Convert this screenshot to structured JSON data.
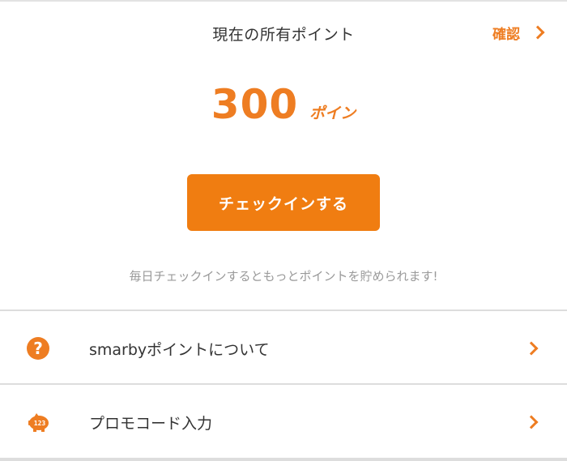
{
  "header": {
    "title": "現在の所有ポイント",
    "confirm_label": "確認"
  },
  "points": {
    "value": "300",
    "unit": "ポイン"
  },
  "checkin": {
    "button_label": "チェックインする",
    "hint": "毎日チェックインするともっとポイントを貯められます!"
  },
  "menu": {
    "items": [
      {
        "label": "smarbyポイントについて",
        "icon": "question-circle-icon"
      },
      {
        "label": "プロモコード入力",
        "icon": "piggy-bank-123-icon"
      }
    ]
  },
  "colors": {
    "accent": "#ee7d22",
    "button": "#f07d11",
    "hint_text": "#9a9a9a",
    "divider": "#dddddd"
  }
}
